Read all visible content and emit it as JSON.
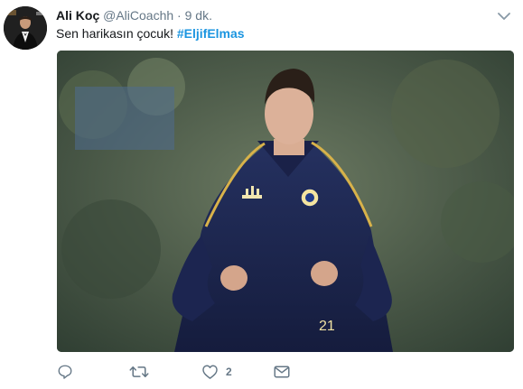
{
  "tweet": {
    "author_name": "Ali Koç",
    "handle": "@AliCoachh",
    "separator": "·",
    "time": "9 dk.",
    "text": "Sen harikasın çocuk!",
    "hashtag": "#EljifElmas"
  },
  "actions": {
    "reply_icon": "reply-icon",
    "retweet_icon": "retweet-icon",
    "like_icon": "heart-icon",
    "like_count": "2",
    "message_icon": "envelope-icon"
  },
  "colors": {
    "link": "#1b95e0",
    "meta": "#657786",
    "text": "#14171a"
  }
}
